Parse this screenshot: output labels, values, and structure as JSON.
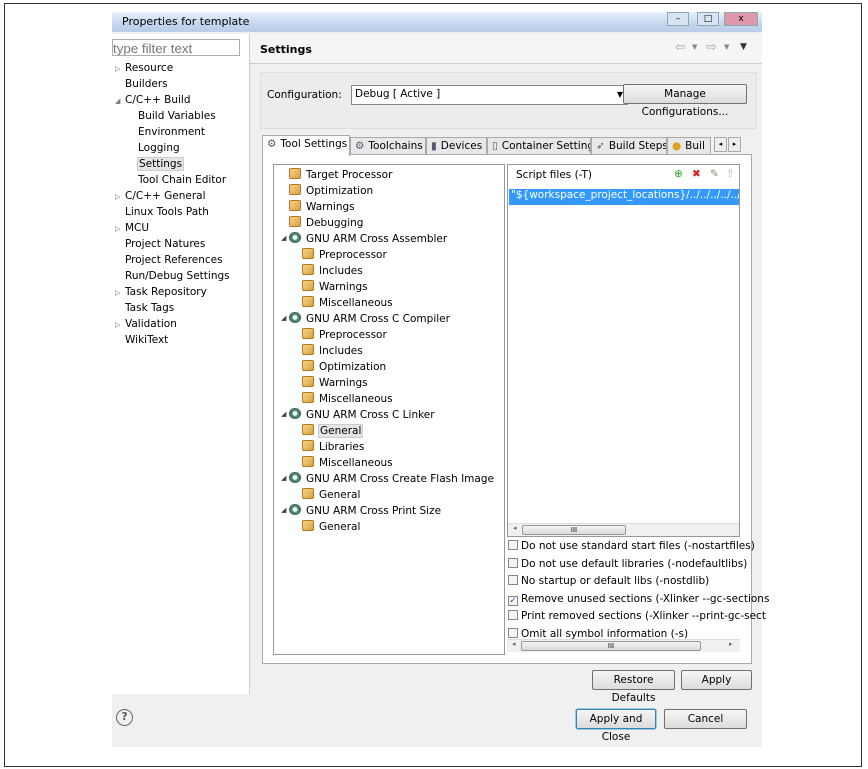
{
  "window": {
    "title": "Properties for template",
    "minimize": "–",
    "maximize": "□",
    "close": "x"
  },
  "left": {
    "filter_placeholder": "type filter text",
    "items": [
      {
        "label": "Resource",
        "level": 0,
        "expand": "collapsed"
      },
      {
        "label": "Builders",
        "level": 0
      },
      {
        "label": "C/C++ Build",
        "level": 0,
        "expand": "expanded"
      },
      {
        "label": "Build Variables",
        "level": 1
      },
      {
        "label": "Environment",
        "level": 1
      },
      {
        "label": "Logging",
        "level": 1
      },
      {
        "label": "Settings",
        "level": 1,
        "selected": true
      },
      {
        "label": "Tool Chain Editor",
        "level": 1
      },
      {
        "label": "C/C++ General",
        "level": 0,
        "expand": "collapsed"
      },
      {
        "label": "Linux Tools Path",
        "level": 0
      },
      {
        "label": "MCU",
        "level": 0,
        "expand": "collapsed"
      },
      {
        "label": "Project Natures",
        "level": 0
      },
      {
        "label": "Project References",
        "level": 0
      },
      {
        "label": "Run/Debug Settings",
        "level": 0
      },
      {
        "label": "Task Repository",
        "level": 0,
        "expand": "collapsed"
      },
      {
        "label": "Task Tags",
        "level": 0
      },
      {
        "label": "Validation",
        "level": 0,
        "expand": "collapsed"
      },
      {
        "label": "WikiText",
        "level": 0
      }
    ]
  },
  "header": {
    "title": "Settings"
  },
  "config": {
    "label": "Configuration:",
    "value": "Debug  [ Active ]",
    "manage": "Manage Configurations..."
  },
  "tabs": [
    {
      "label": "Tool Settings",
      "active": true
    },
    {
      "label": "Toolchains"
    },
    {
      "label": "Devices"
    },
    {
      "label": "Container Settings"
    },
    {
      "label": "Build Steps"
    },
    {
      "label": "Buil"
    }
  ],
  "tree": [
    {
      "label": "Target Processor",
      "level": 0,
      "icon": "folder"
    },
    {
      "label": "Optimization",
      "level": 0,
      "icon": "folder"
    },
    {
      "label": "Warnings",
      "level": 0,
      "icon": "folder"
    },
    {
      "label": "Debugging",
      "level": 0,
      "icon": "folder"
    },
    {
      "label": "GNU ARM Cross Assembler",
      "level": 0,
      "icon": "gear",
      "expand": true
    },
    {
      "label": "Preprocessor",
      "level": 1,
      "icon": "folder"
    },
    {
      "label": "Includes",
      "level": 1,
      "icon": "folder"
    },
    {
      "label": "Warnings",
      "level": 1,
      "icon": "folder"
    },
    {
      "label": "Miscellaneous",
      "level": 1,
      "icon": "folder"
    },
    {
      "label": "GNU ARM Cross C Compiler",
      "level": 0,
      "icon": "gear",
      "expand": true
    },
    {
      "label": "Preprocessor",
      "level": 1,
      "icon": "folder"
    },
    {
      "label": "Includes",
      "level": 1,
      "icon": "folder"
    },
    {
      "label": "Optimization",
      "level": 1,
      "icon": "folder"
    },
    {
      "label": "Warnings",
      "level": 1,
      "icon": "folder"
    },
    {
      "label": "Miscellaneous",
      "level": 1,
      "icon": "folder"
    },
    {
      "label": "GNU ARM Cross C Linker",
      "level": 0,
      "icon": "gear",
      "expand": true
    },
    {
      "label": "General",
      "level": 1,
      "icon": "folder",
      "selected": true
    },
    {
      "label": "Libraries",
      "level": 1,
      "icon": "folder"
    },
    {
      "label": "Miscellaneous",
      "level": 1,
      "icon": "folder"
    },
    {
      "label": "GNU ARM Cross Create Flash Image",
      "level": 0,
      "icon": "gear",
      "expand": true
    },
    {
      "label": "General",
      "level": 1,
      "icon": "folder"
    },
    {
      "label": "GNU ARM Cross Print Size",
      "level": 0,
      "icon": "gear",
      "expand": true
    },
    {
      "label": "General",
      "level": 1,
      "icon": "folder"
    }
  ],
  "script": {
    "title": "Script files (-T)",
    "value": "\"${workspace_project_locations}/../../../../../librarie"
  },
  "options": [
    {
      "label": "Do not use standard start files (-nostartfiles)",
      "checked": false
    },
    {
      "label": "Do not use default libraries (-nodefaultlibs)",
      "checked": false
    },
    {
      "label": "No startup or default libs (-nostdlib)",
      "checked": false
    },
    {
      "label": "Remove unused sections (-Xlinker --gc-sections",
      "checked": true
    },
    {
      "label": "Print removed sections (-Xlinker --print-gc-sect",
      "checked": false
    },
    {
      "label": "Omit all symbol information (-s)",
      "checked": false
    }
  ],
  "buttons": {
    "restore": "Restore Defaults",
    "apply": "Apply",
    "apply_close": "Apply and Close",
    "cancel": "Cancel",
    "help": "?"
  },
  "scroll_thumb": "III",
  "check_mark": "✓"
}
